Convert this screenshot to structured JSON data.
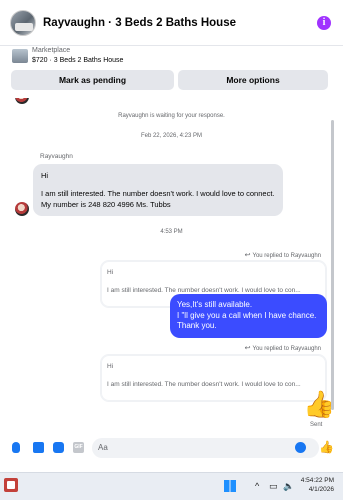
{
  "header": {
    "title": "Rayvaughn · 3 Beds 2 Baths House",
    "info_icon": "info-icon"
  },
  "marketplace": {
    "label": "Marketplace",
    "item": "$720 · 3 Beds 2 Baths House",
    "mark_pending_label": "Mark as pending",
    "more_options_label": "More options"
  },
  "chat": {
    "waiting_notice": "Rayvaughn is waiting for your response.",
    "timestamp_1": "Feb 22, 2026, 4:23 PM",
    "sender_name": "Rayvaughn",
    "incoming_message": {
      "line1": "Hi",
      "line2": "I am still interested.  The number doesn't work. I would love to connect. My number is 248 820 4996 Ms. Tubbs"
    },
    "timestamp_2": "4:53 PM",
    "reply_note_1": "You replied to Rayvaughn",
    "quote_1": {
      "line1": "Hi",
      "line2": "I am still interested.  The number doesn't work. I would love to con..."
    },
    "outgoing_message": "Yes,It's still available.\nI \"ll give you a call when I have chance. Thank you.",
    "reply_note_2": "You replied to Rayvaughn",
    "quote_2": {
      "line1": "Hi",
      "line2": "I am still interested.  The number doesn't work. I would love to con..."
    },
    "status": "Sent"
  },
  "composer": {
    "placeholder": "Aa",
    "gif_label": "GIF"
  },
  "taskbar": {
    "time": "4:54:22 PM",
    "date": "4/1/2026"
  },
  "colors": {
    "accent": "#3b4cff",
    "messenger_blue": "#1877f2",
    "info_purple": "#a033ff"
  }
}
